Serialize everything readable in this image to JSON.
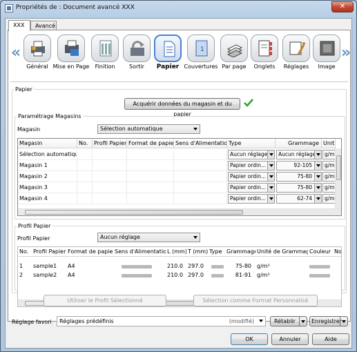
{
  "window": {
    "title": "Propriétés de : Document avancé XXX",
    "close_label": "✕"
  },
  "tabs": [
    {
      "label": "XXX"
    },
    {
      "label": "Avancé"
    }
  ],
  "toolbar": {
    "items": [
      {
        "label": "Général",
        "icon": "printer-settings-icon"
      },
      {
        "label": "Mise en Page",
        "icon": "layout-icon"
      },
      {
        "label": "Finition",
        "icon": "finishing-icon"
      },
      {
        "label": "Sortir",
        "icon": "output-tray-icon"
      },
      {
        "label": "Papier",
        "icon": "paper-icon",
        "selected": true
      },
      {
        "label": "Couvertures",
        "icon": "cover-icon"
      },
      {
        "label": "Par page",
        "icon": "per-page-icon"
      },
      {
        "label": "Onglets",
        "icon": "tabs-icon"
      },
      {
        "label": "Réglages",
        "icon": "adjustments-icon"
      },
      {
        "label": "Image",
        "icon": "image-icon"
      }
    ],
    "prev_arrow": "«",
    "next_arrow": "»"
  },
  "papier": {
    "section_label": "Papier",
    "acquire_button": "Acquérir données du magasin et du papier",
    "status_icon": "check-icon",
    "status_color": "#2aa52a"
  },
  "magasins": {
    "group_label": "Paramétrage Magasins",
    "select_label": "Magasin",
    "select_value": "Sélection automatique",
    "headers": [
      "Magasin",
      "No.",
      "Profil Papier",
      "Format de papier",
      "Sens d'Alimentation",
      "Type",
      "Grammage",
      "Unit"
    ],
    "rows": [
      {
        "magasin": "Sélection automatique",
        "type": "Aucun réglage",
        "grammage": "Aucun réglage",
        "unit": "g/m"
      },
      {
        "magasin": "Magasin 1",
        "type": "Papier ordin...",
        "grammage": "92-105",
        "unit": "g/m"
      },
      {
        "magasin": "Magasin 2",
        "type": "Papier ordin...",
        "grammage": "75-80",
        "unit": "g/m"
      },
      {
        "magasin": "Magasin 3",
        "type": "Papier ordin...",
        "grammage": "75-80",
        "unit": "g/m"
      },
      {
        "magasin": "Magasin 4",
        "type": "Papier ordin...",
        "grammage": "62-74",
        "unit": "g/m"
      }
    ]
  },
  "profil": {
    "group_label": "Profil Papier",
    "select_label": "Profil Papier",
    "select_value": "Aucun réglage",
    "headers": [
      "No.",
      "Profil Papier",
      "Format de papier",
      "Sens d'Alimentation",
      "L (mm)",
      "T (mm)",
      "Type",
      "Grammage",
      "Unité de Grammage",
      "Couleur",
      "Nor"
    ],
    "rows": [
      {
        "no": "1",
        "profil": "sample1",
        "format": "A4",
        "l": "210.0",
        "t": "297.0",
        "grammage": "75-80",
        "unite": "g/m²"
      },
      {
        "no": "2",
        "profil": "sample2",
        "format": "A4",
        "l": "210.0",
        "t": "297.0",
        "grammage": "81-91",
        "unite": "g/m²"
      }
    ],
    "use_button": "Utiliser le Profil Sélectionné",
    "custom_button": "Sélection comme Format Personnalisé"
  },
  "favori": {
    "label": "Réglage favori",
    "value": "Réglages prédéfinis",
    "modified": "(modifié)",
    "reset_button": "Rétablir",
    "save_button": "Enregistrer"
  },
  "footer": {
    "ok": "OK",
    "cancel": "Annuler",
    "help": "Aide"
  }
}
